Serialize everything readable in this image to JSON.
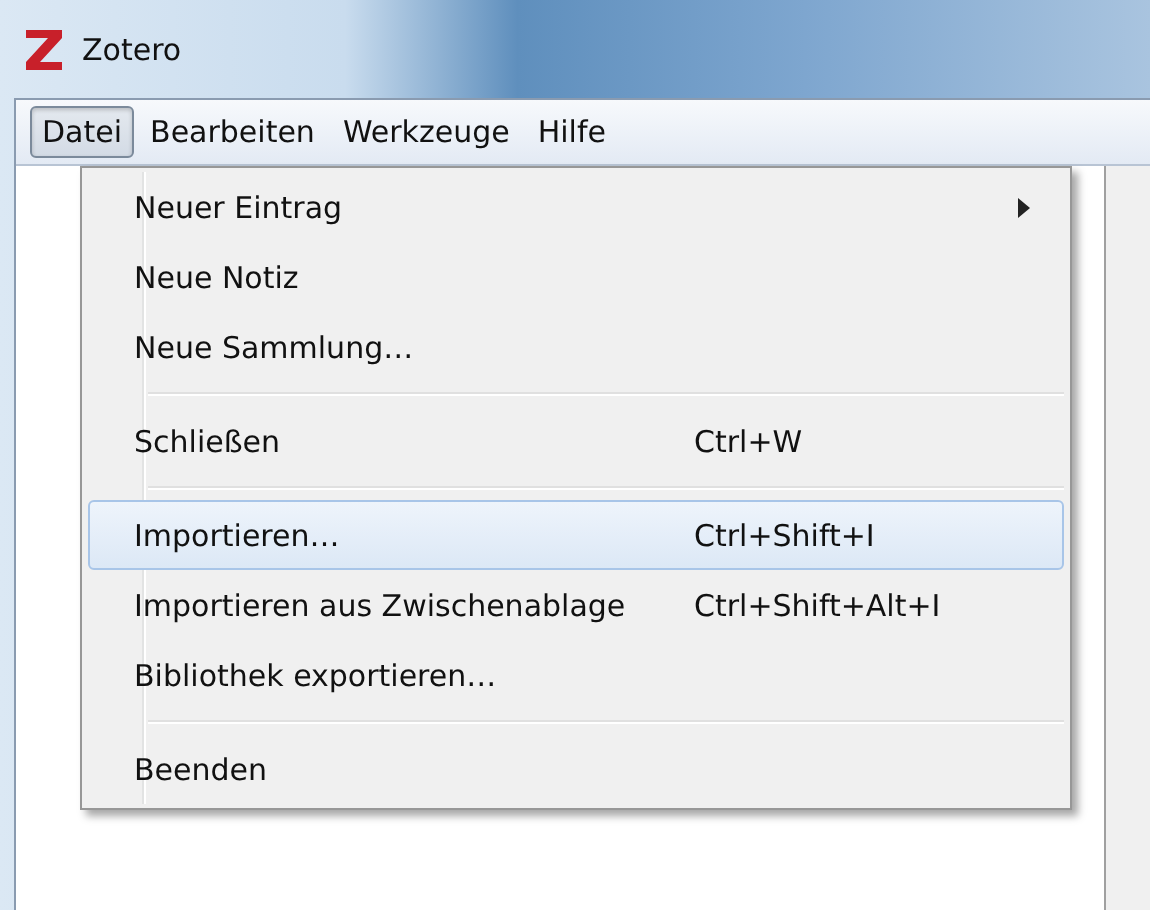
{
  "window": {
    "title": "Zotero"
  },
  "menubar": [
    {
      "label": "Datei",
      "selected": true
    },
    {
      "label": "Bearbeiten",
      "selected": false
    },
    {
      "label": "Werkzeuge",
      "selected": false
    },
    {
      "label": "Hilfe",
      "selected": false
    }
  ],
  "menu": {
    "items": [
      {
        "kind": "item",
        "label": "Neuer Eintrag",
        "submenu": true,
        "highlighted": false
      },
      {
        "kind": "item",
        "label": "Neue Notiz",
        "submenu": false,
        "highlighted": false
      },
      {
        "kind": "item",
        "label": "Neue Sammlung…",
        "submenu": false,
        "highlighted": false
      },
      {
        "kind": "separator"
      },
      {
        "kind": "item",
        "label": "Schließen",
        "shortcut": "Ctrl+W",
        "submenu": false,
        "highlighted": false
      },
      {
        "kind": "separator"
      },
      {
        "kind": "item",
        "label": "Importieren…",
        "shortcut": "Ctrl+Shift+I",
        "submenu": false,
        "highlighted": true
      },
      {
        "kind": "item",
        "label": "Importieren aus Zwischenablage",
        "shortcut": "Ctrl+Shift+Alt+I",
        "submenu": false,
        "highlighted": false
      },
      {
        "kind": "item",
        "label": "Bibliothek exportieren…",
        "submenu": false,
        "highlighted": false
      },
      {
        "kind": "separator"
      },
      {
        "kind": "item",
        "label": "Beenden",
        "submenu": false,
        "highlighted": false
      }
    ]
  }
}
